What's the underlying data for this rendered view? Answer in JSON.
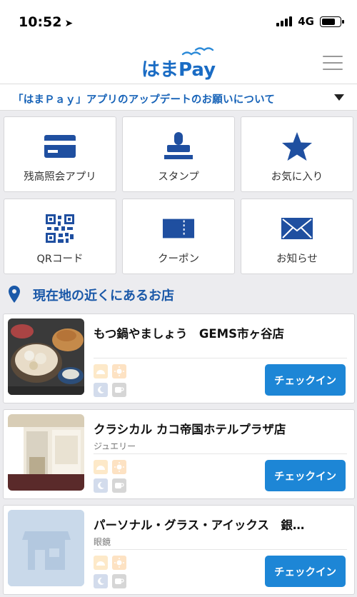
{
  "status_bar": {
    "time": "10:52",
    "network": "4G"
  },
  "header": {
    "logo_text": "はまPay"
  },
  "notice": {
    "text": "「はまＰａｙ」アプリのアップデートのお願いについて"
  },
  "menu": [
    {
      "label": "残高照会アプリ",
      "icon": "card-icon"
    },
    {
      "label": "スタンプ",
      "icon": "stamp-icon"
    },
    {
      "label": "お気に入り",
      "icon": "star-icon"
    },
    {
      "label": "QRコード",
      "icon": "qr-icon"
    },
    {
      "label": "クーポン",
      "icon": "ticket-icon"
    },
    {
      "label": "お知らせ",
      "icon": "mail-icon"
    }
  ],
  "nearby": {
    "title": "現在地の近くにあるお店"
  },
  "shops": [
    {
      "name": "もつ鍋やましょう　GEMS市ヶ谷店",
      "category": "",
      "checkin": "チェックイン"
    },
    {
      "name": "クラシカル カコ帝国ホテルプラザ店",
      "category": "ジュエリー",
      "checkin": "チェックイン"
    },
    {
      "name": "パーソナル・グラス・アイックス　銀…",
      "category": "眼鏡",
      "checkin": "チェックイン"
    }
  ],
  "colors": {
    "brand_blue": "#1a58a8",
    "checkin_blue": "#1d86d6",
    "icon_navy": "#1f4fa0"
  }
}
